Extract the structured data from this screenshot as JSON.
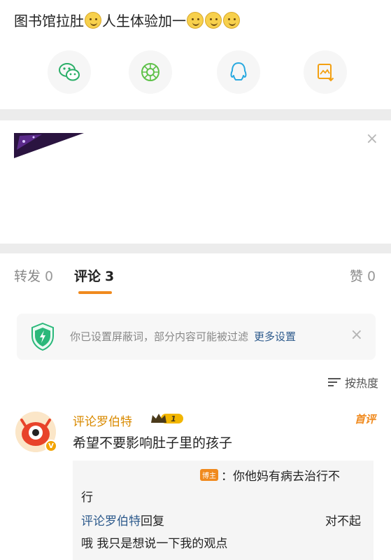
{
  "post": {
    "text_parts": [
      "图书馆拉肚",
      "人生体验加一"
    ],
    "emoji_name": "smile-emoji"
  },
  "share": {
    "items": [
      {
        "name": "wechat-icon",
        "color": "#2aae67"
      },
      {
        "name": "moments-icon",
        "color": "#5ec149"
      },
      {
        "name": "qq-icon",
        "color": "#29a9e0"
      },
      {
        "name": "save-image-icon",
        "color": "#f3a012"
      }
    ]
  },
  "ad": {
    "close": "×"
  },
  "tabs": {
    "repost_label": "转发",
    "repost_count": "0",
    "comment_label": "评论",
    "comment_count": "3",
    "like_label": "赞",
    "like_count": "0",
    "accent": "#f08a1e"
  },
  "notice": {
    "text": "你已设置屏蔽词，部分内容可能被过滤",
    "link": "更多设置",
    "close": "×"
  },
  "sort": {
    "label": "按热度"
  },
  "comment": {
    "author": "评论罗伯特",
    "level": "1",
    "tag": "首评",
    "text": "希望不要影响肚子里的孩子",
    "replies": {
      "first_badge": "博主",
      "first_line1": "：你他妈有病去治行不",
      "first_line2": "行",
      "second_author": "评论罗伯特",
      "second_verb": "回复",
      "second_right": "对不起",
      "second_text": "哦 我只是想说一下我的观点"
    }
  }
}
